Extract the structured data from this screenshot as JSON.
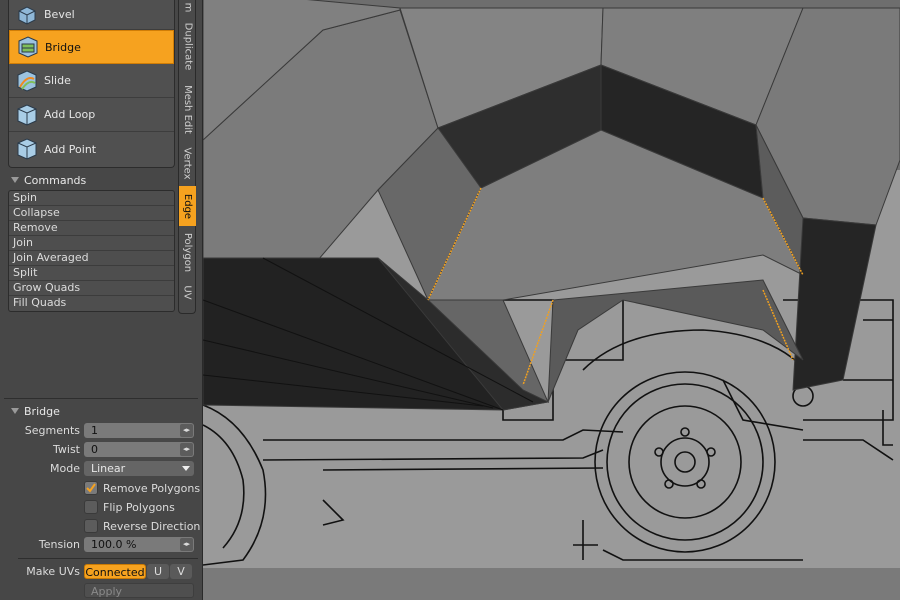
{
  "tools": [
    {
      "label": "Bevel",
      "icon": "bevel-icon",
      "active": false
    },
    {
      "label": "Bridge",
      "icon": "bridge-icon",
      "active": true
    },
    {
      "label": "Slide",
      "icon": "slide-icon",
      "active": false
    },
    {
      "label": "Add Loop",
      "icon": "add-loop-icon",
      "active": false
    },
    {
      "label": "Add Point",
      "icon": "add-point-icon",
      "active": false
    }
  ],
  "commands": {
    "title": "Commands",
    "items": [
      "Spin",
      "Collapse",
      "Remove",
      "Join",
      "Join Averaged",
      "Split",
      "Grow Quads",
      "Fill Quads"
    ]
  },
  "tabs": [
    "m",
    "Duplicate",
    "Mesh Edit",
    "Vertex",
    "Edge",
    "Polygon",
    "UV"
  ],
  "active_tab": "Edge",
  "bridge": {
    "title": "Bridge",
    "segments_label": "Segments",
    "segments_value": "1",
    "twist_label": "Twist",
    "twist_value": "0",
    "mode_label": "Mode",
    "mode_value": "Linear",
    "remove_polygons_label": "Remove Polygons",
    "remove_polygons_checked": true,
    "flip_polygons_label": "Flip Polygons",
    "flip_polygons_checked": false,
    "reverse_direction_label": "Reverse Direction",
    "reverse_direction_checked": false,
    "tension_label": "Tension",
    "tension_value": "100.0 %",
    "make_uvs_label": "Make UVs",
    "make_uvs_connected": "Connected",
    "make_uvs_u": "U",
    "make_uvs_v": "V",
    "apply_label": "Apply"
  },
  "colors": {
    "accent": "#f6a21f",
    "panel": "#474747",
    "viewport_bg": "#6e6e6e",
    "mesh_light": "#7b7b7b",
    "mesh_dark": "#2a2a2a",
    "selected_edge": "#f0a020"
  }
}
